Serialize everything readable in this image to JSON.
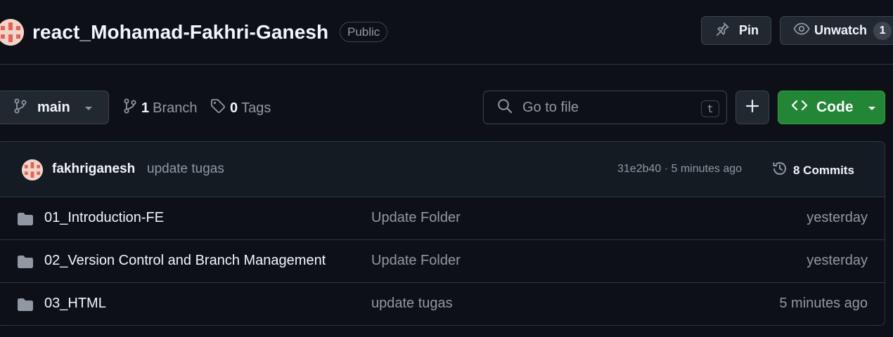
{
  "repo": {
    "name": "react_Mohamad-Fakhri-Ganesh",
    "visibility": "Public"
  },
  "actions": {
    "pin_label": "Pin",
    "watch_label": "Unwatch",
    "watch_count": "1"
  },
  "toolbar": {
    "branch_name": "main",
    "branch_count": "1",
    "branch_label": "Branch",
    "tag_count": "0",
    "tag_label": "Tags",
    "search_placeholder": "Go to file",
    "search_shortcut": "t",
    "code_label": "Code"
  },
  "commit": {
    "author": "fakhriganesh",
    "message": "update tugas",
    "sha_time": "31e2b40 · 5 minutes ago",
    "commits_label": "8 Commits"
  },
  "files": [
    {
      "name": "01_Introduction-FE",
      "message": "Update Folder",
      "date": "yesterday",
      "icon": "folder-icon"
    },
    {
      "name": "02_Version Control and Branch Management",
      "message": "Update Folder",
      "date": "yesterday",
      "icon": "folder-icon"
    },
    {
      "name": "03_HTML",
      "message": "update tugas",
      "date": "5 minutes ago",
      "icon": "folder-icon"
    }
  ],
  "colors": {
    "background": "#0d1117",
    "border": "#30363d",
    "text_primary": "#f0f6fc",
    "text_muted": "#9198a1",
    "code_button": "#238636",
    "avatar": "#f3d4cc"
  }
}
